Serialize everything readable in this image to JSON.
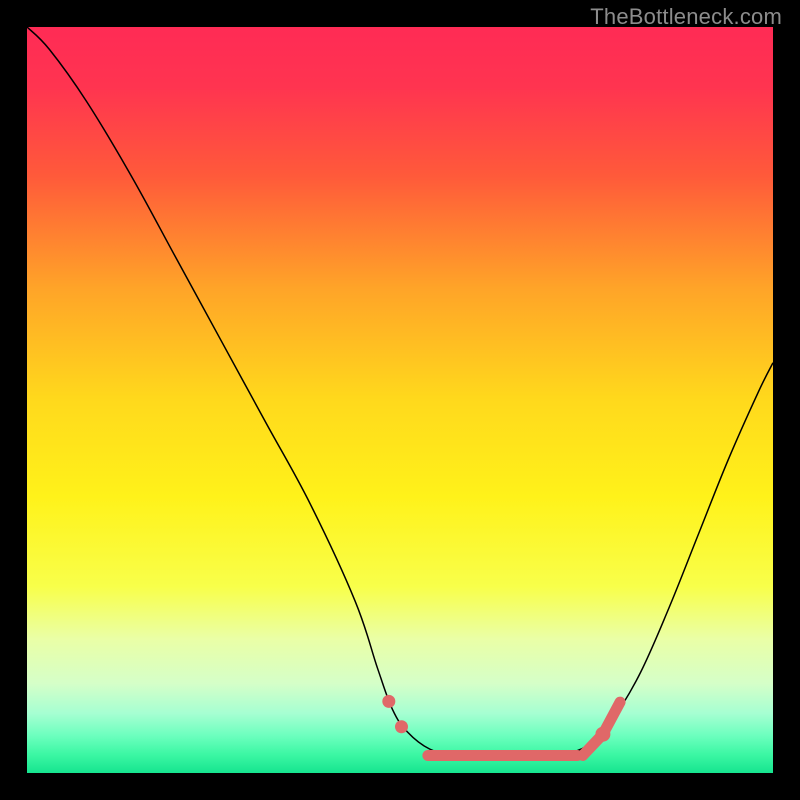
{
  "watermark": "TheBottleneck.com",
  "chart_data": {
    "type": "line",
    "title": "",
    "xlabel": "",
    "ylabel": "",
    "xlim": [
      0,
      100
    ],
    "ylim": [
      0,
      100
    ],
    "gradient_stops": [
      {
        "offset": 0.0,
        "color": "#ff2b55"
      },
      {
        "offset": 0.08,
        "color": "#ff3450"
      },
      {
        "offset": 0.2,
        "color": "#ff5a3a"
      },
      {
        "offset": 0.35,
        "color": "#ffa428"
      },
      {
        "offset": 0.5,
        "color": "#ffd91c"
      },
      {
        "offset": 0.63,
        "color": "#fff21a"
      },
      {
        "offset": 0.75,
        "color": "#f8ff4a"
      },
      {
        "offset": 0.82,
        "color": "#eaffa6"
      },
      {
        "offset": 0.88,
        "color": "#d5ffc8"
      },
      {
        "offset": 0.92,
        "color": "#a6ffd2"
      },
      {
        "offset": 0.95,
        "color": "#6cffbe"
      },
      {
        "offset": 0.975,
        "color": "#3cf7a4"
      },
      {
        "offset": 1.0,
        "color": "#16e58f"
      }
    ],
    "series": [
      {
        "name": "bottleneck-curve",
        "color": "#000000",
        "width": 1.5,
        "x": [
          0,
          3,
          8,
          14,
          20,
          26,
          32,
          38,
          44,
          47,
          49,
          51,
          54,
          57,
          60,
          64,
          68,
          72,
          75,
          78,
          82,
          86,
          90,
          94,
          98,
          100
        ],
        "y": [
          100,
          97,
          90,
          80,
          69,
          58,
          47,
          36,
          23,
          14,
          8.5,
          5.5,
          3.2,
          2.5,
          2.2,
          2.2,
          2.3,
          2.6,
          3.6,
          6.5,
          13,
          22,
          32,
          42,
          51,
          55
        ]
      }
    ],
    "overlay": {
      "name": "optimal-band",
      "color": "#e06868",
      "dot_radius": 6.5,
      "cap_radius": 7.5,
      "band_height": 11,
      "dots": [
        {
          "x": 48.5,
          "y": 9.6
        },
        {
          "x": 50.2,
          "y": 6.2
        }
      ],
      "band": {
        "x_start": 53,
        "x_end": 74.5,
        "y": 2.35
      },
      "right_cap": {
        "x": 77.2,
        "y": 5.2
      },
      "right_tail_end": {
        "x": 79.5,
        "y": 9.5
      }
    }
  }
}
